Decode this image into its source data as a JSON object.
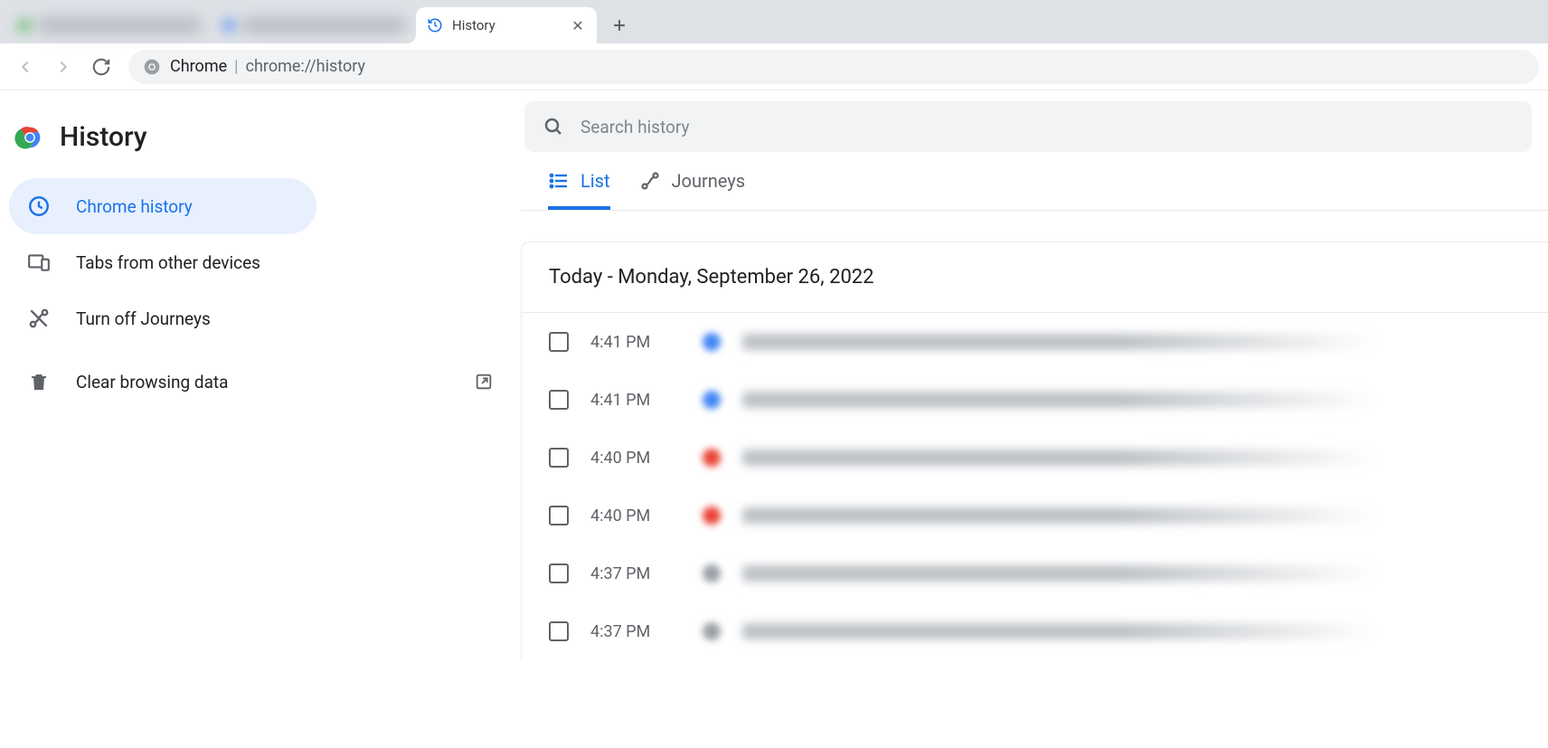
{
  "tabs": {
    "active_title": "History"
  },
  "omnibox": {
    "scheme": "Chrome",
    "url": "chrome://history"
  },
  "page": {
    "title": "History"
  },
  "sidebar": {
    "items": [
      {
        "label": "Chrome history"
      },
      {
        "label": "Tabs from other devices"
      },
      {
        "label": "Turn off Journeys"
      },
      {
        "label": "Clear browsing data"
      }
    ]
  },
  "search": {
    "placeholder": "Search history"
  },
  "view_tabs": {
    "list": "List",
    "journeys": "Journeys"
  },
  "history": {
    "date_header": "Today - Monday, September 26, 2022",
    "rows": [
      {
        "time": "4:41 PM",
        "favicon": "blue"
      },
      {
        "time": "4:41 PM",
        "favicon": "blue"
      },
      {
        "time": "4:40 PM",
        "favicon": "red"
      },
      {
        "time": "4:40 PM",
        "favicon": "red"
      },
      {
        "time": "4:37 PM",
        "favicon": "grey"
      },
      {
        "time": "4:37 PM",
        "favicon": "grey"
      }
    ]
  }
}
